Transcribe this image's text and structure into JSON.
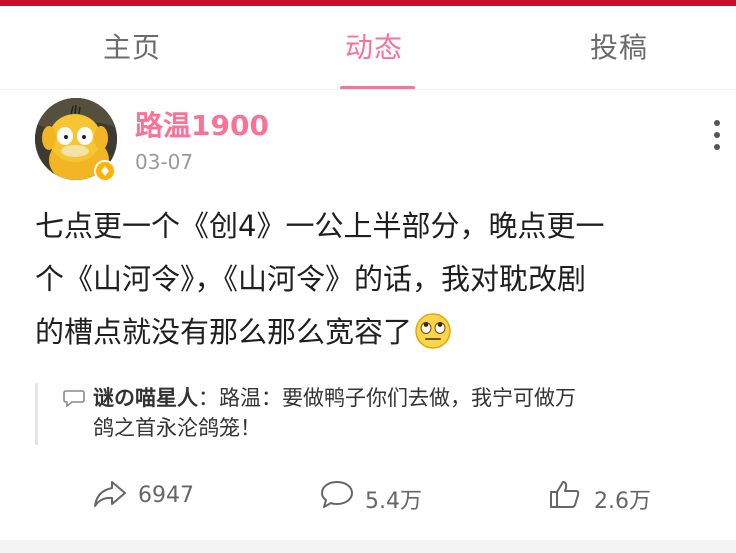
{
  "tabs": [
    {
      "label": "主页",
      "active": false
    },
    {
      "label": "动态",
      "active": true
    },
    {
      "label": "投稿",
      "active": false
    }
  ],
  "colors": {
    "accent": "#fb7299",
    "top_strip": "#c8102e",
    "badge": "#ffb300"
  },
  "post": {
    "author": "路温1900",
    "date": "03-07",
    "avatar_icon": "psyduck-avatar",
    "text_lines": [
      "七点更一个《创4》一公上半部分，晚点更一",
      "个《山河令》，《山河令》的话，我对耽改剧",
      "的槽点就没有那么那么宽容了"
    ],
    "emoji": "eye-roll-emoji"
  },
  "reply": {
    "user": "谜の喵星人",
    "separator": "：",
    "text_line1": "路温：要做鸭子你们去做，我宁可做万",
    "text_line2": "鸽之首永沦鸽笼！"
  },
  "actions": {
    "share_count": "6947",
    "comment_count": "5.4万",
    "like_count": "2.6万"
  }
}
